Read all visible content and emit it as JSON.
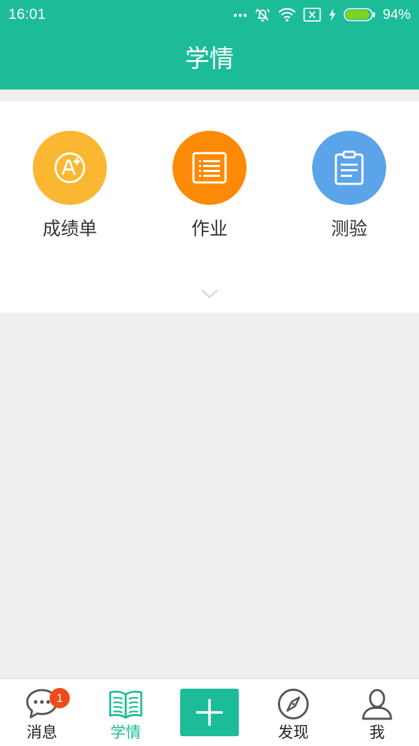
{
  "status_bar": {
    "time": "16:01",
    "battery_percent": "94%",
    "battery_level": 0.94,
    "icons": [
      "more-dots-icon",
      "alarm-muted-icon",
      "wifi-icon",
      "sim-none-icon",
      "charging-icon",
      "battery-icon"
    ]
  },
  "header": {
    "title": "学情"
  },
  "features": [
    {
      "label": "成绩单",
      "icon": "grade-a-plus-icon",
      "color": "#fbb731"
    },
    {
      "label": "作业",
      "icon": "homework-list-icon",
      "color": "#fd8a06"
    },
    {
      "label": "测验",
      "icon": "clipboard-quiz-icon",
      "color": "#5ba4ea"
    }
  ],
  "expand_icon": "chevron-down-icon",
  "tabbar": {
    "tabs": [
      {
        "label": "消息",
        "icon": "chat-bubble-icon",
        "badge": "1",
        "active": false
      },
      {
        "label": "学情",
        "icon": "open-book-icon",
        "active": true
      },
      {
        "label": "",
        "icon": "plus-icon",
        "active": false
      },
      {
        "label": "发现",
        "icon": "compass-icon",
        "active": false
      },
      {
        "label": "我",
        "icon": "user-icon",
        "active": false
      }
    ]
  },
  "colors": {
    "primary": "#1dbc98",
    "background": "#efefee",
    "badge": "#f04a1b",
    "text": "#333333"
  }
}
